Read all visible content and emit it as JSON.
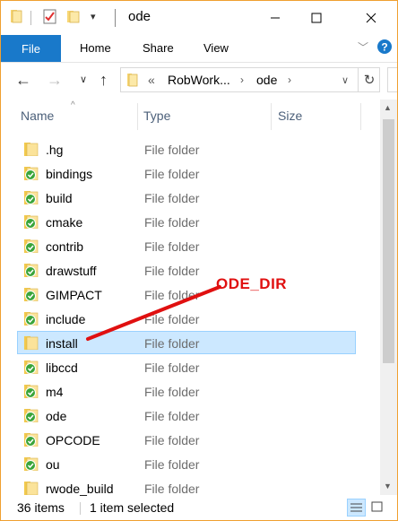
{
  "window": {
    "title": "ode"
  },
  "ribbon": {
    "file": "File",
    "tabs": [
      "Home",
      "Share",
      "View"
    ]
  },
  "address": {
    "overflow": "«",
    "crumbs": [
      "RobWork...",
      "ode"
    ]
  },
  "columns": {
    "name": "Name",
    "type": "Type",
    "size": "Size"
  },
  "files": [
    {
      "name": ".hg",
      "type": "File folder",
      "icon": "folder-icon"
    },
    {
      "name": "bindings",
      "type": "File folder",
      "icon": "synced-folder-icon"
    },
    {
      "name": "build",
      "type": "File folder",
      "icon": "synced-folder-icon"
    },
    {
      "name": "cmake",
      "type": "File folder",
      "icon": "synced-folder-icon"
    },
    {
      "name": "contrib",
      "type": "File folder",
      "icon": "synced-folder-icon"
    },
    {
      "name": "drawstuff",
      "type": "File folder",
      "icon": "synced-folder-icon"
    },
    {
      "name": "GIMPACT",
      "type": "File folder",
      "icon": "synced-folder-icon"
    },
    {
      "name": "include",
      "type": "File folder",
      "icon": "synced-folder-icon"
    },
    {
      "name": "install",
      "type": "File folder",
      "icon": "folder-icon",
      "selected": true
    },
    {
      "name": "libccd",
      "type": "File folder",
      "icon": "synced-folder-icon"
    },
    {
      "name": "m4",
      "type": "File folder",
      "icon": "synced-folder-icon"
    },
    {
      "name": "ode",
      "type": "File folder",
      "icon": "synced-folder-icon"
    },
    {
      "name": "OPCODE",
      "type": "File folder",
      "icon": "synced-folder-icon"
    },
    {
      "name": "ou",
      "type": "File folder",
      "icon": "synced-folder-icon"
    },
    {
      "name": "rwode_build",
      "type": "File folder",
      "icon": "folder-icon"
    }
  ],
  "status": {
    "count": "36 items",
    "selection": "1 item selected"
  },
  "annotation": {
    "label": "ODE_DIR",
    "color": "#e01010"
  },
  "colors": {
    "accent": "#1979ca",
    "selection": "#cce8ff",
    "folder": "#f8d775",
    "sync": "#3aa53a"
  }
}
